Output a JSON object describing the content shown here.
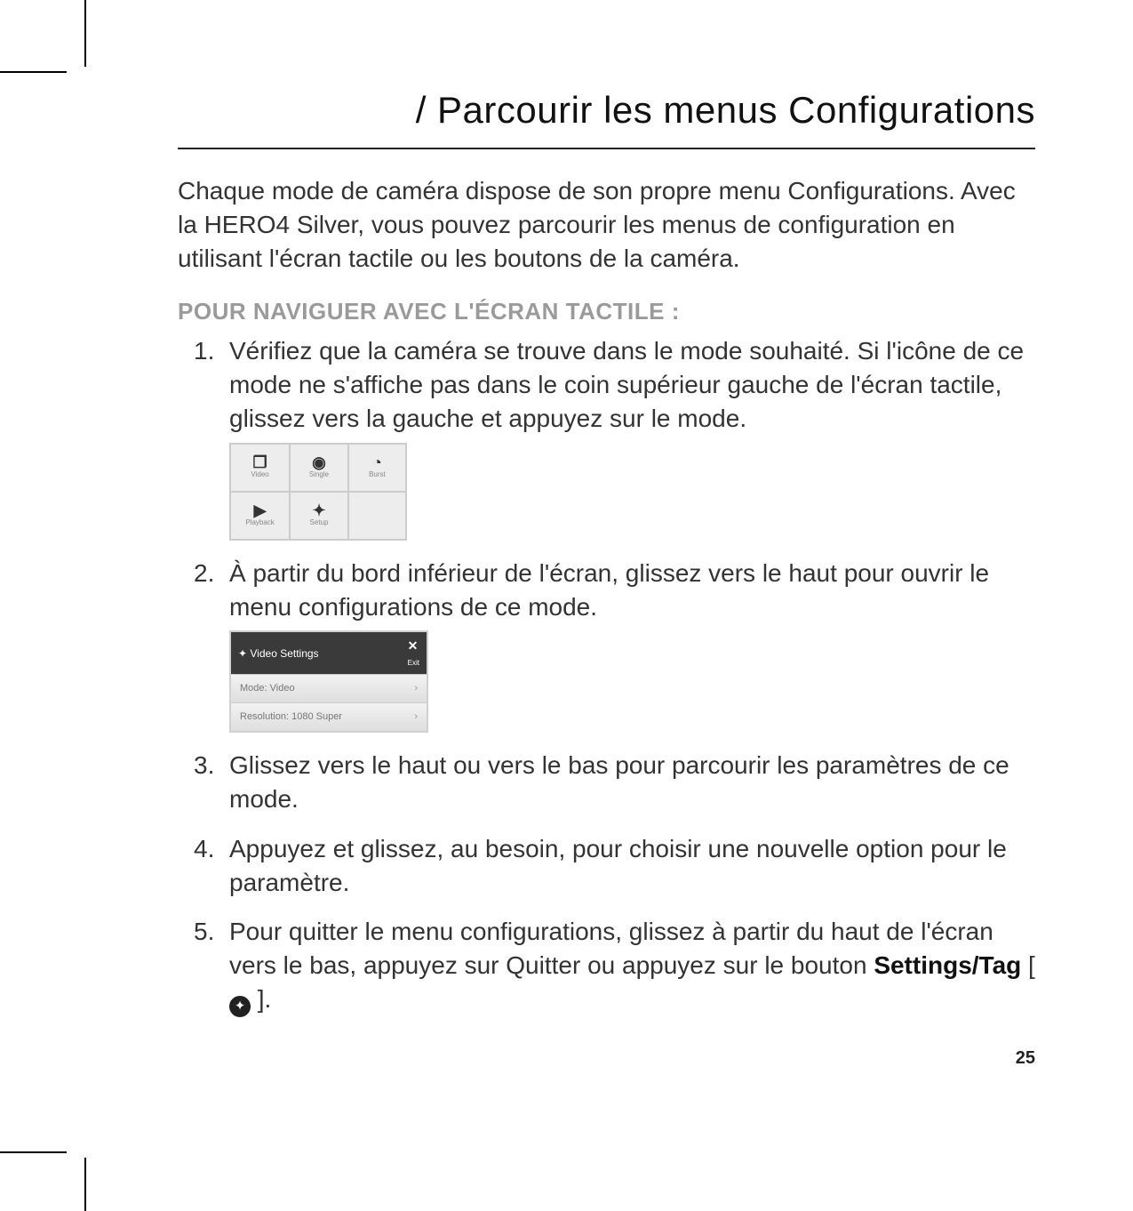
{
  "title": "/ Parcourir les menus Configurations",
  "intro": "Chaque mode de caméra dispose de son propre menu Configurations. Avec la HERO4 Silver, vous pouvez parcourir les menus de configuration en utilisant l'écran tactile ou les boutons de la caméra.",
  "section_heading": "POUR NAVIGUER AVEC L'ÉCRAN TACTILE :",
  "steps": {
    "s1": "Vérifiez que la caméra se trouve dans le mode souhaité. Si l'icône de ce mode ne s'affiche pas dans le coin supérieur gauche de l'écran tactile, glissez vers la gauche et appuyez sur le mode.",
    "s2": "À partir du bord inférieur de l'écran, glissez vers le haut pour ouvrir le menu configurations de ce mode.",
    "s3": "Glissez vers le haut ou vers le bas pour parcourir les paramètres de ce mode.",
    "s4": "Appuyez et glissez, au besoin, pour choisir une nouvelle option pour le paramètre.",
    "s5_pre": "Pour quitter le menu configurations, glissez à partir du haut de l'écran vers le bas, appuyez sur Quitter ou appuyez sur le bouton ",
    "s5_bold": "Settings/Tag",
    "s5_post_open": " [ ",
    "s5_post_close": " ]."
  },
  "mode_grid": {
    "c0": {
      "icon": "❐",
      "label": "Video"
    },
    "c1": {
      "icon": "◉",
      "label": "Single"
    },
    "c2": {
      "icon": "◔",
      "label": "Burst"
    },
    "c3": {
      "icon": "▶",
      "label": "Playback"
    },
    "c4": {
      "icon": "✦",
      "label": "Setup"
    }
  },
  "settings_panel": {
    "title": "Video Settings",
    "exit": "✕",
    "exit_label": "Exit",
    "row1": "Mode: Video",
    "row2": "Resolution: 1080 Super"
  },
  "page_number": "25"
}
